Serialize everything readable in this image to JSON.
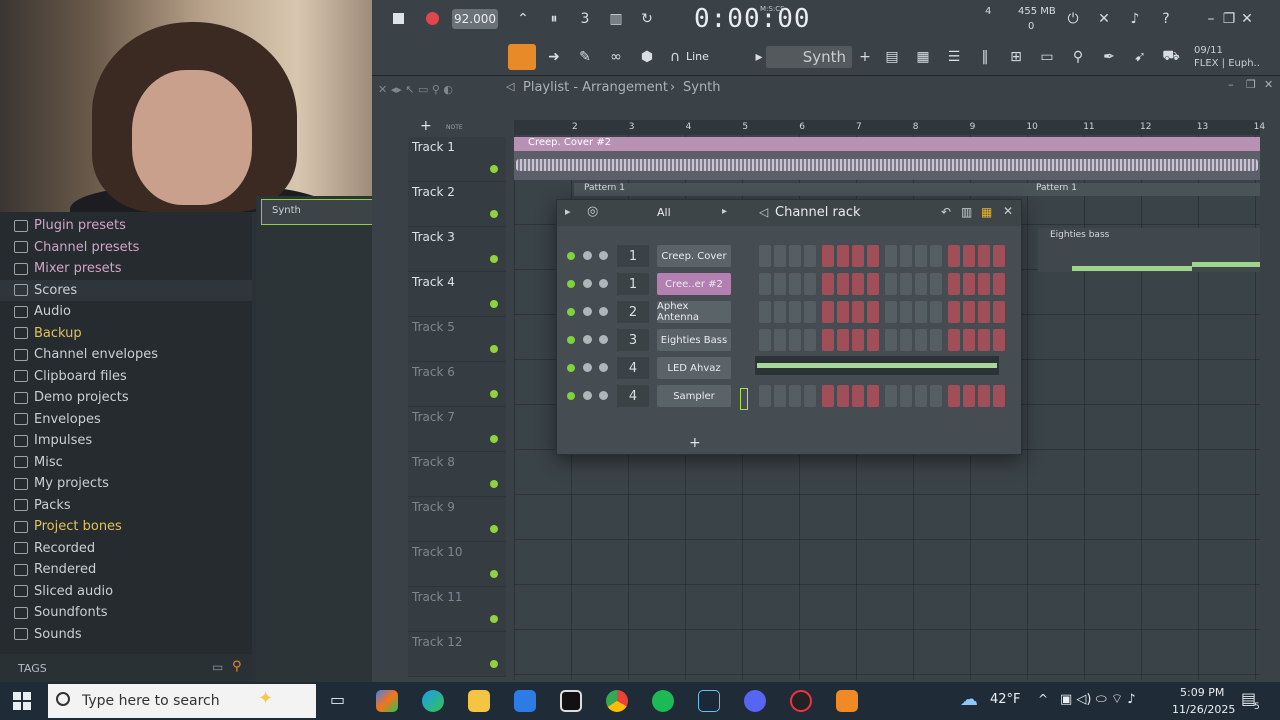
{
  "toolbar": {
    "tempo": "92.000",
    "time_display": "0:00:00",
    "time_label": "M:S:CS",
    "cpu_value": "4",
    "memory": "455 MB",
    "memory_sub": "0",
    "snap_mode": "Line",
    "pattern_name": "Synth",
    "hint_line1": "09/11",
    "hint_line2": "FLEX | Euph.."
  },
  "playlist": {
    "breadcrumb": "Playlist - Arrangement",
    "breadcrumb_sep": "›",
    "breadcrumb_pattern": "Synth",
    "ruler": [
      "2",
      "3",
      "4",
      "5",
      "6",
      "7",
      "8",
      "9",
      "10",
      "11",
      "12",
      "13",
      "14"
    ],
    "tracks": [
      "Track 1",
      "Track 2",
      "Track 3",
      "Track 4",
      "Track 5",
      "Track 6",
      "Track 7",
      "Track 8",
      "Track 9",
      "Track 10",
      "Track 11",
      "Track 12"
    ],
    "audio_clip": "Creep. Cover #2",
    "pattern_clip_1": "Pattern 1",
    "pattern_clip_2": "Pattern 1",
    "bass_clip": "Eighties bass"
  },
  "browser": {
    "items": [
      "Plugin presets",
      "Channel presets",
      "Mixer presets",
      "Scores",
      "Audio",
      "Backup",
      "Channel envelopes",
      "Clipboard files",
      "Demo projects",
      "Envelopes",
      "Impulses",
      "Misc",
      "My projects",
      "Packs",
      "Project bones",
      "Recorded",
      "Rendered",
      "Sliced audio",
      "Soundfonts",
      "Sounds"
    ],
    "tags_label": "TAGS",
    "synth_clip": "Synth"
  },
  "channel_rack": {
    "title": "Channel rack",
    "filter": "All",
    "channels": [
      {
        "num": "1",
        "name": "Creep. Cover"
      },
      {
        "num": "1",
        "name": "Cree..er #2"
      },
      {
        "num": "2",
        "name": "Aphex Antenna"
      },
      {
        "num": "3",
        "name": "Eighties Bass"
      },
      {
        "num": "4",
        "name": "LED Ahvaz"
      },
      {
        "num": "4",
        "name": "Sampler"
      }
    ],
    "add_label": "+"
  },
  "taskbar": {
    "search_placeholder": "Type here to search",
    "temperature": "42°F",
    "time": "5:09 PM",
    "date": "11/26/2025",
    "notification_count": "5"
  },
  "colors": {
    "accent_green": "#8fd43d",
    "step_red": "#a04e57",
    "selected_channel": "#b27fb0",
    "audio_clip": "#b891b5"
  }
}
